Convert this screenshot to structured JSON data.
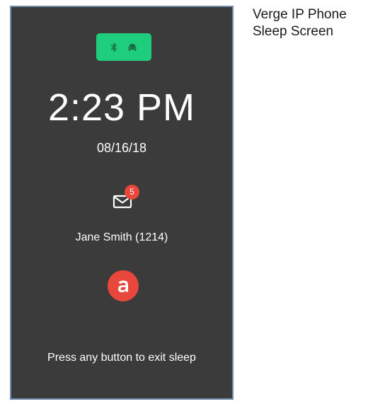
{
  "phone": {
    "status": {
      "icons": [
        "bluetooth-icon",
        "car-icon"
      ],
      "color": "#1fce7c"
    },
    "time": "2:23 PM",
    "date": "08/16/18",
    "voicemail": {
      "icon": "envelope-icon",
      "count": "5",
      "badge_color": "#e8473b"
    },
    "user_label": "Jane Smith (1214)",
    "logo": {
      "icon": "brand-a-logo",
      "color": "#e8473b"
    },
    "exit_hint": "Press any button to exit sleep"
  },
  "caption": {
    "line1": "Verge IP Phone",
    "line2": "Sleep Screen"
  }
}
